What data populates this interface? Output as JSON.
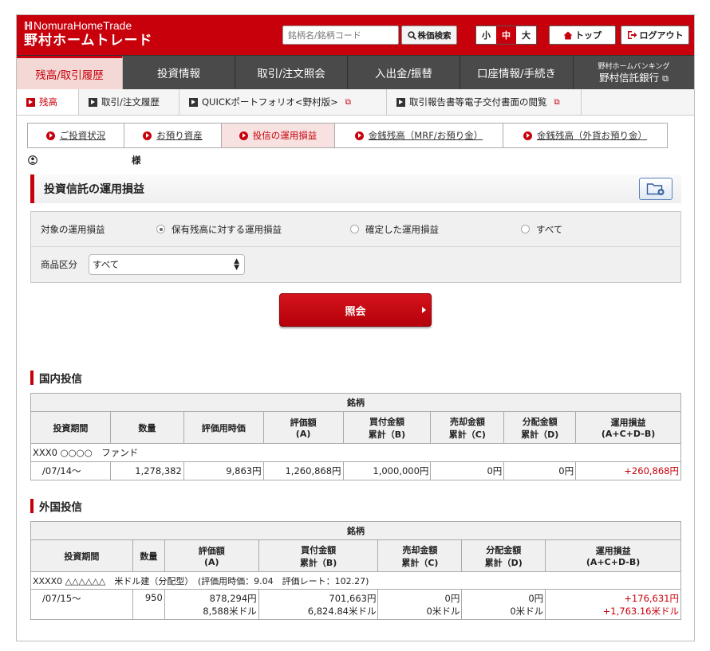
{
  "header": {
    "logo_en": "NomuraHomeTrade",
    "logo_jp": "野村ホームトレード",
    "search_placeholder": "銘柄名/銘柄コード",
    "search_button": "株価検索",
    "font_sizes": [
      {
        "label": "小",
        "active": false
      },
      {
        "label": "中",
        "active": true
      },
      {
        "label": "大",
        "active": false
      }
    ],
    "top_button": "トップ",
    "logout_button": "ログアウト"
  },
  "main_nav": {
    "items": [
      {
        "label": "残高/取引履歴",
        "active": true
      },
      {
        "label": "投資情報",
        "active": false
      },
      {
        "label": "取引/注文照会",
        "active": false
      },
      {
        "label": "入出金/振替",
        "active": false
      },
      {
        "label": "口座情報/手続き",
        "active": false
      }
    ],
    "bank_small": "野村ホームバンキング",
    "bank_large": "野村信託銀行"
  },
  "sub_nav": {
    "items": [
      {
        "label": "残高",
        "active": true
      },
      {
        "label": "取引/注文履歴",
        "active": false
      },
      {
        "label": "QUICKポートフォリオ<野村版>",
        "active": false
      },
      {
        "label": "取引報告書等電子交付書面の閲覧",
        "active": false
      }
    ]
  },
  "tabs": [
    {
      "label": "ご投資状況",
      "active": false
    },
    {
      "label": "お預り資産",
      "active": false
    },
    {
      "label": "投信の運用損益",
      "active": true
    },
    {
      "label": "金銭残高（MRF/お預り金）",
      "active": false
    },
    {
      "label": "金銭残高（外貨お預り金）",
      "active": false
    }
  ],
  "user": {
    "suffix": "様"
  },
  "page_title": "投資信託の運用損益",
  "filter": {
    "target_label": "対象の運用損益",
    "options": [
      {
        "label": "保有残高に対する運用損益",
        "selected": true
      },
      {
        "label": "確定した運用損益",
        "selected": false
      },
      {
        "label": "すべて",
        "selected": false
      }
    ],
    "category_label": "商品区分",
    "category_value": "すべて"
  },
  "query_button": "照会",
  "domestic": {
    "title": "国内投信",
    "top_header": "銘柄",
    "headers": [
      {
        "l1": "投資期間",
        "l2": ""
      },
      {
        "l1": "数量",
        "l2": ""
      },
      {
        "l1": "評価用時価",
        "l2": ""
      },
      {
        "l1": "評価額",
        "l2": "(A)"
      },
      {
        "l1": "買付金額",
        "l2": "累計（B)"
      },
      {
        "l1": "売却金額",
        "l2": "累計（C)"
      },
      {
        "l1": "分配金額",
        "l2": "累計（D)"
      },
      {
        "l1": "運用損益",
        "l2": "(A+C+D-B)"
      }
    ],
    "fund_name": "XXX0 ○○○○　ファンド",
    "row": {
      "period": "/07/14～",
      "quantity": "1,278,382",
      "eval_price": "9,863円",
      "eval_amount": "1,260,868円",
      "purchase": "1,000,000円",
      "sale": "0円",
      "distribution": "0円",
      "pnl": "+260,868円"
    }
  },
  "foreign": {
    "title": "外国投信",
    "top_header": "銘柄",
    "headers": [
      {
        "l1": "投資期間",
        "l2": ""
      },
      {
        "l1": "数量",
        "l2": ""
      },
      {
        "l1": "評価額",
        "l2": "(A)"
      },
      {
        "l1": "買付金額",
        "l2": "累計（B)"
      },
      {
        "l1": "売却金額",
        "l2": "累計（C)"
      },
      {
        "l1": "分配金額",
        "l2": "累計（D)"
      },
      {
        "l1": "運用損益",
        "l2": "(A+C+D-B)"
      }
    ],
    "fund_name": "XXXX0 △△△△△△　米ドル建（分配型）　(評価用時価：9.04　評価レート：102.27)",
    "row": {
      "period": "/07/15～",
      "quantity": "950",
      "eval_jpy": "878,294円",
      "eval_usd": "8,588米ドル",
      "purchase_jpy": "701,663円",
      "purchase_usd": "6,824.84米ドル",
      "sale_jpy": "0円",
      "sale_usd": "0米ドル",
      "dist_jpy": "0円",
      "dist_usd": "0米ドル",
      "pnl_jpy": "+176,631円",
      "pnl_usd": "+1,763.16米ドル"
    }
  },
  "colors": {
    "brand": "#c7000b",
    "nav": "#4a4a4a",
    "positive": "#c7000b"
  }
}
